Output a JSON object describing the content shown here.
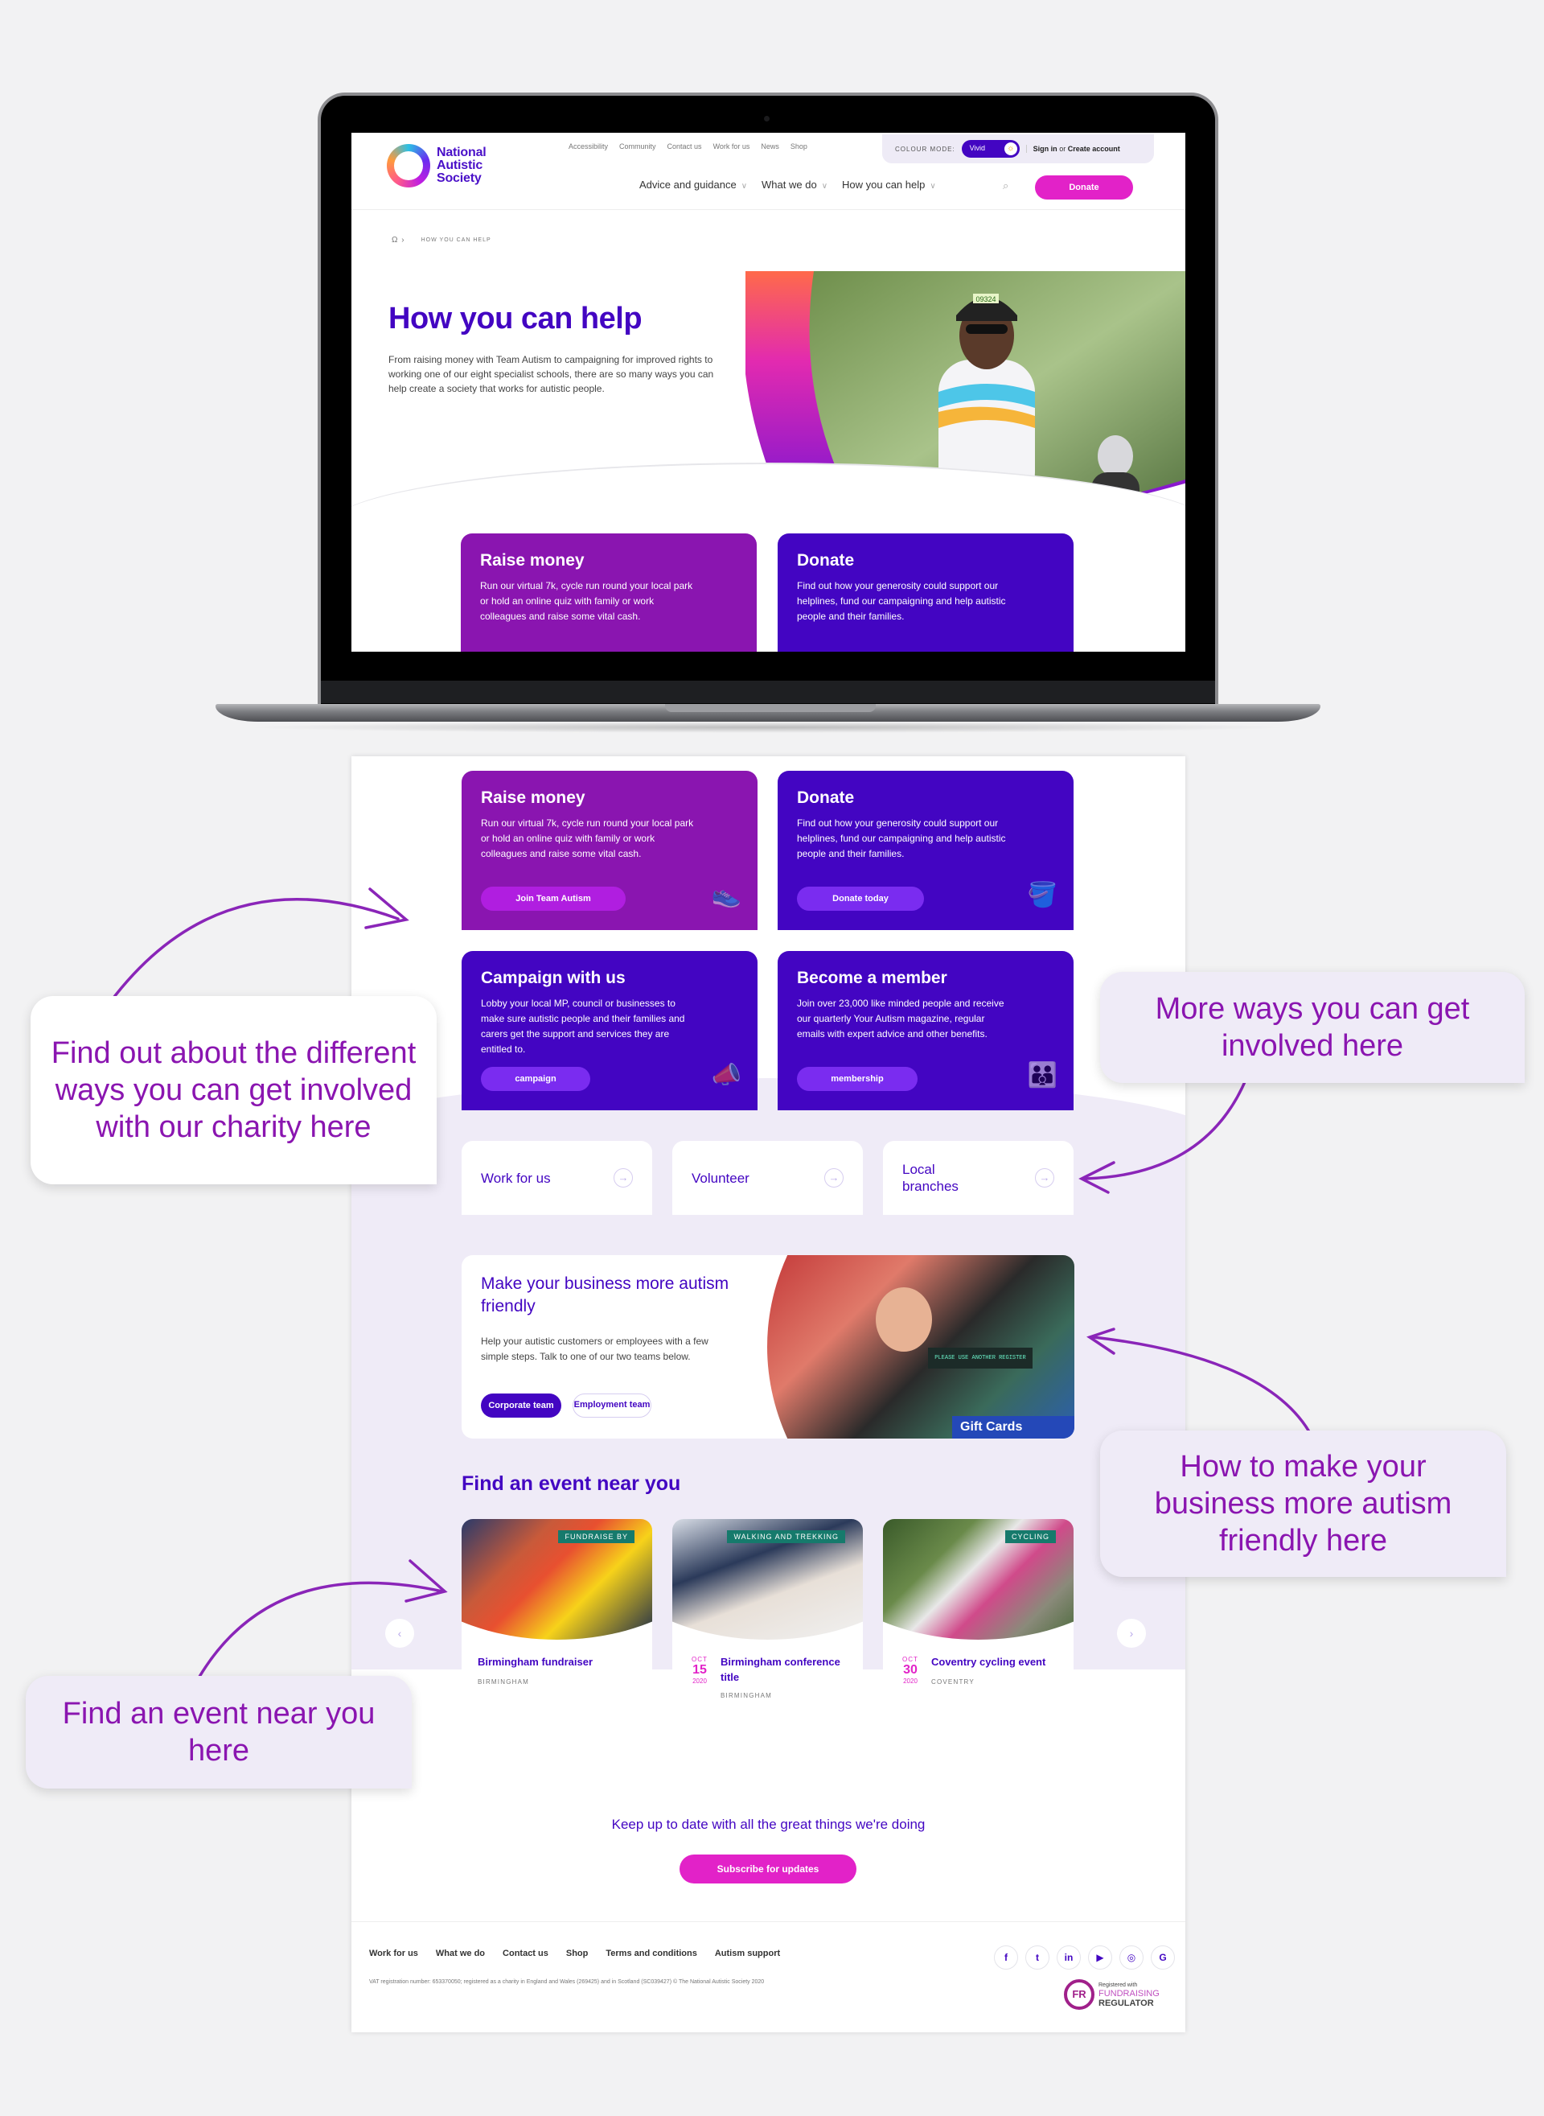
{
  "site": {
    "logo_lines": [
      "National",
      "Autistic",
      "Society"
    ],
    "utility_nav": [
      "Accessibility",
      "Community",
      "Contact us",
      "Work for us",
      "News",
      "Shop"
    ],
    "colour_mode_label": "COLOUR MODE:",
    "colour_mode_value": "Vivid",
    "sign_in": "Sign in",
    "or": "or",
    "create_account": "Create account",
    "main_nav": [
      "Advice and guidance",
      "What we do",
      "How you can help"
    ],
    "donate_label": "Donate",
    "breadcrumb": "HOW YOU CAN HELP"
  },
  "hero": {
    "title": "How you can help",
    "text": "From raising money with Team Autism to campaigning for improved rights to working one of our eight specialist schools, there are so many ways you can help create a society that works for autistic people.",
    "bib_number": "09324"
  },
  "cards": [
    {
      "title": "Raise money",
      "text": "Run our virtual 7k, cycle run round your local park or hold an online quiz with family or work colleagues and raise some vital cash.",
      "button": "Join Team Autism",
      "icon": "trainer-icon"
    },
    {
      "title": "Donate",
      "text": "Find out how your generosity could support our helplines, fund our campaigning and help autistic people and their families.",
      "button": "Donate today",
      "icon": "donation-bucket-icon"
    },
    {
      "title": "Campaign with us",
      "text": "Lobby your local MP, council or businesses to make sure autistic people and their families and carers get the support and services they are entitled to.",
      "button": "campaign",
      "icon": "megaphone-icon"
    },
    {
      "title": "Become a member",
      "text": "Join over 23,000 like minded people and receive our quarterly Your Autism magazine, regular emails with expert advice and other benefits.",
      "button": "membership",
      "icon": "people-group-icon"
    }
  ],
  "more_links": [
    {
      "label": "Work for us"
    },
    {
      "label": "Volunteer"
    },
    {
      "label": "Local branches"
    }
  ],
  "business": {
    "title": "Make your business more autism friendly",
    "text": "Help your autistic customers or employees with a few simple steps. Talk to one of our two teams below.",
    "btn_primary": "Corporate team",
    "btn_secondary": "Employment team",
    "image_sign": "PLEASE USE ANOTHER REGISTER",
    "image_gift": "Gift Cards"
  },
  "events": {
    "title": "Find an event near you",
    "items": [
      {
        "tag": "FUNDRAISE BY",
        "title": "Birmingham fundraiser",
        "location": "BIRMINGHAM",
        "month": "",
        "day": "",
        "year": ""
      },
      {
        "tag": "WALKING AND TREKKING",
        "title": "Birmingham conference title",
        "location": "BIRMINGHAM",
        "month": "OCT",
        "day": "15",
        "year": "2020"
      },
      {
        "tag": "CYCLING",
        "title": "Coventry cycling event",
        "location": "COVENTRY",
        "month": "OCT",
        "day": "30",
        "year": "2020"
      }
    ],
    "prev": "‹",
    "next": "›"
  },
  "subscribe": {
    "text": "Keep up to date with all the great things we're doing",
    "button": "Subscribe for updates"
  },
  "footer": {
    "links": [
      "Work for us",
      "What we do",
      "Contact us",
      "Shop",
      "Terms and conditions",
      "Autism support"
    ],
    "legal": "VAT registration number: 653370050; registered as a charity in England and Wales (269425) and in Scotland (SC039427) © The National Autistic Society 2020",
    "social": [
      {
        "name": "facebook-icon",
        "glyph": "f"
      },
      {
        "name": "twitter-icon",
        "glyph": "t"
      },
      {
        "name": "linkedin-icon",
        "glyph": "in"
      },
      {
        "name": "youtube-icon",
        "glyph": "▶"
      },
      {
        "name": "instagram-icon",
        "glyph": "◎"
      },
      {
        "name": "google-icon",
        "glyph": "G"
      }
    ],
    "regulator_small": "Registered with",
    "regulator_line1": "FUNDRAISING",
    "regulator_line2": "REGULATOR",
    "regulator_mark": "FR"
  },
  "annotations": {
    "ways": "Find out about the different ways you can get involved with our charity here",
    "more": "More ways you can get involved here",
    "business": "How to make your business more autism friendly here",
    "events": "Find an event near you here"
  },
  "colors": {
    "brand_indigo": "#4305c2",
    "brand_purple": "#8a15b0",
    "brand_magenta": "#e222c8",
    "annotation_text": "#8a15b0",
    "lilac_bg": "#efebf7",
    "tag_teal": "#167a6c"
  }
}
